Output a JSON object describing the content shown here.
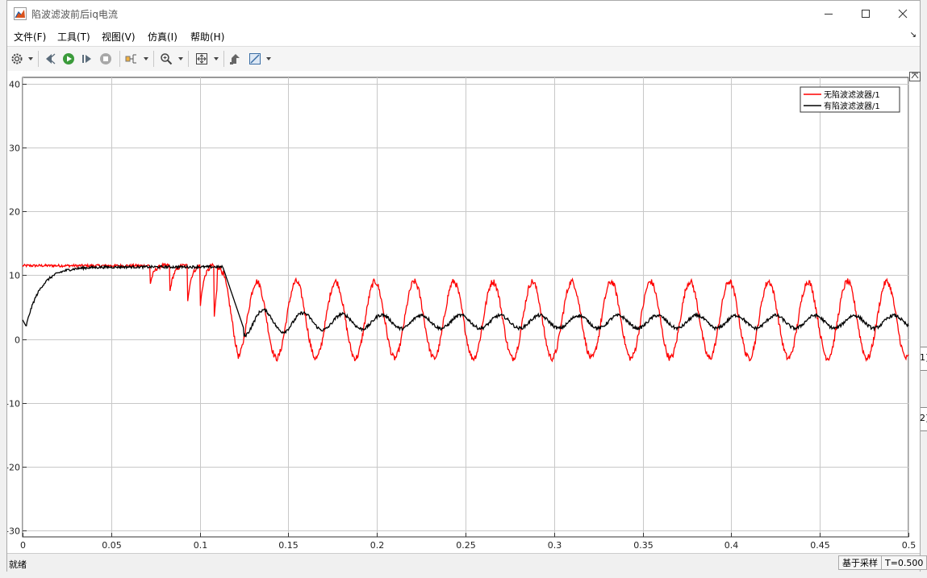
{
  "window": {
    "title": "陷波滤波前后iq电流",
    "icon": "matlab-scope-icon"
  },
  "menu": [
    {
      "label": "文件(F)"
    },
    {
      "label": "工具(T)"
    },
    {
      "label": "视图(V)"
    },
    {
      "label": "仿真(I)"
    },
    {
      "label": "帮助(H)"
    }
  ],
  "toolbar": {
    "icons": [
      "gear-icon",
      "step-back-icon",
      "run-icon",
      "step-forward-icon",
      "stop-icon",
      "signal-select-icon",
      "zoom-icon",
      "fit-view-icon",
      "restore-icon",
      "cursor-measure-icon"
    ]
  },
  "status": {
    "left": "就绪",
    "mode": "基于采样",
    "time": "T=0.500"
  },
  "side_fragments": [
    "1]",
    "2]"
  ],
  "chart_data": {
    "type": "line",
    "xlim": [
      0,
      0.5
    ],
    "ylim": [
      -31,
      41
    ],
    "x_ticks": [
      "0",
      "0.05",
      "0.1",
      "0.15",
      "0.2",
      "0.25",
      "0.3",
      "0.35",
      "0.4",
      "0.45",
      "0.5"
    ],
    "y_ticks": [
      "40",
      "30",
      "20",
      "10",
      "0",
      "-10",
      "-20",
      "-30"
    ],
    "grid": true,
    "legend_position": "top-right",
    "colors": {
      "no_notch": "#ff0000",
      "with_notch": "#000000"
    },
    "series": [
      {
        "name": "无陷波滤波器/1",
        "color": "#ff0000",
        "initial_value": 11.5,
        "disturbance_start": 0.07,
        "dip_times": [
          0.072,
          0.083,
          0.093,
          0.1,
          0.108
        ],
        "oscillation": {
          "start": 0.11,
          "offset": 3.0,
          "amplitude": 6.0,
          "frequency_hz": 45,
          "noise_band": 1.0
        }
      },
      {
        "name": "有陷波滤波器/1",
        "color": "#000000",
        "initial_value": 3.0,
        "rise_tau": 0.008,
        "settled_value": 11.3,
        "drop_start": 0.113,
        "trough_value": 1.5,
        "trough_time": 0.125,
        "oscillation": {
          "offset": 2.7,
          "amplitude": 1.0,
          "frequency_hz": 45
        }
      }
    ]
  }
}
